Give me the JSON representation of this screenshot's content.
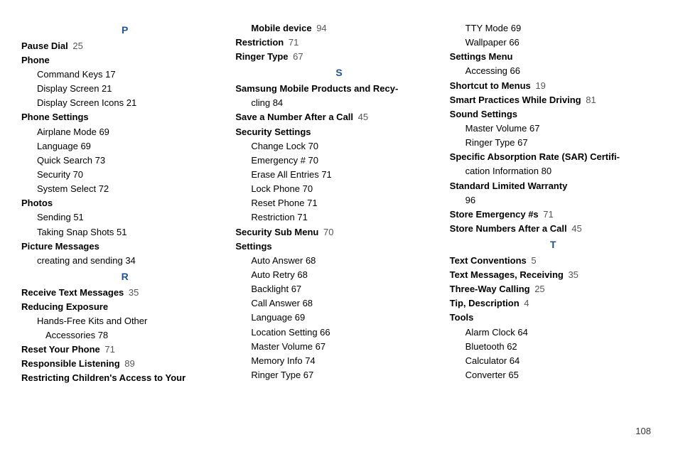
{
  "page_number": "108",
  "columns": [
    {
      "groups": [
        {
          "letter": "P",
          "entries": [
            {
              "title": "Pause Dial",
              "page": "25"
            },
            {
              "title": "Phone",
              "subs": [
                {
                  "label": "Command Keys",
                  "page": "17"
                },
                {
                  "label": "Display Screen",
                  "page": "21"
                },
                {
                  "label": "Display Screen Icons",
                  "page": "21"
                }
              ]
            },
            {
              "title": "Phone Settings",
              "subs": [
                {
                  "label": "Airplane Mode",
                  "page": "69"
                },
                {
                  "label": "Language",
                  "page": "69"
                },
                {
                  "label": "Quick Search",
                  "page": "73"
                },
                {
                  "label": "Security",
                  "page": "70"
                },
                {
                  "label": "System Select",
                  "page": "72"
                }
              ]
            },
            {
              "title": "Photos",
              "subs": [
                {
                  "label": "Sending",
                  "page": "51"
                },
                {
                  "label": "Taking Snap Shots",
                  "page": "51"
                }
              ]
            },
            {
              "title": "Picture Messages",
              "subs": [
                {
                  "label": "creating and sending",
                  "page": "34"
                }
              ]
            }
          ]
        },
        {
          "letter": "R",
          "entries": [
            {
              "title": "Receive Text Messages",
              "page": "35"
            },
            {
              "title": "Reducing Exposure",
              "subs": [
                {
                  "label": "Hands-Free Kits and Other",
                  "cont": "Accessories",
                  "page": "78"
                }
              ]
            },
            {
              "title": "Reset Your Phone",
              "page": "71"
            },
            {
              "title": "Responsible Listening",
              "page": "89"
            },
            {
              "title": "Restricting Children's Access to Your"
            }
          ]
        }
      ]
    },
    {
      "groups": [
        {
          "entries": [
            {
              "indent": true,
              "title": "Mobile device",
              "page": "94"
            },
            {
              "title": "Restriction",
              "page": "71"
            },
            {
              "title": "Ringer Type",
              "page": "67"
            }
          ]
        },
        {
          "letter": "S",
          "entries": [
            {
              "title": "Samsung Mobile Products and Recy-",
              "cont_title": "cling",
              "page": "84"
            },
            {
              "title": "Save a Number After a Call",
              "page": "45"
            },
            {
              "title": "Security Settings",
              "subs": [
                {
                  "label": "Change Lock",
                  "page": "70"
                },
                {
                  "label": "Emergency #",
                  "page": "70"
                },
                {
                  "label": "Erase All Entries",
                  "page": "71"
                },
                {
                  "label": "Lock Phone",
                  "page": "70"
                },
                {
                  "label": "Reset Phone",
                  "page": "71"
                },
                {
                  "label": "Restriction",
                  "page": "71"
                }
              ]
            },
            {
              "title": "Security Sub Menu",
              "page": "70"
            },
            {
              "title": "Settings",
              "subs": [
                {
                  "label": "Auto Answer",
                  "page": "68"
                },
                {
                  "label": "Auto Retry",
                  "page": "68"
                },
                {
                  "label": "Backlight",
                  "page": "67"
                },
                {
                  "label": "Call Answer",
                  "page": "68"
                },
                {
                  "label": "Language",
                  "page": "69"
                },
                {
                  "label": "Location Setting",
                  "page": "66"
                },
                {
                  "label": "Master Volume",
                  "page": "67"
                },
                {
                  "label": "Memory Info",
                  "page": "74"
                },
                {
                  "label": "Ringer Type",
                  "page": "67"
                }
              ]
            }
          ]
        }
      ]
    },
    {
      "groups": [
        {
          "entries": [
            {
              "pre_subs": [
                {
                  "label": "TTY Mode",
                  "page": "69"
                },
                {
                  "label": "Wallpaper",
                  "page": "66"
                }
              ]
            },
            {
              "title": "Settings Menu",
              "subs": [
                {
                  "label": "Accessing",
                  "page": "66"
                }
              ]
            },
            {
              "title": "Shortcut to Menus",
              "page": "19"
            },
            {
              "title": "Smart Practices While Driving",
              "page": "81"
            },
            {
              "title": "Sound Settings",
              "subs": [
                {
                  "label": "Master Volume",
                  "page": "67"
                },
                {
                  "label": "Ringer Type",
                  "page": "67"
                }
              ]
            },
            {
              "title": "Specific Absorption Rate (SAR) Certifi-",
              "cont_title": "cation Information",
              "page": "80"
            },
            {
              "title": "Standard Limited Warranty",
              "cont_page_only": "96"
            },
            {
              "title": "Store Emergency #s",
              "page": "71"
            },
            {
              "title": "Store Numbers After a Call",
              "page": "45"
            }
          ]
        },
        {
          "letter": "T",
          "entries": [
            {
              "title": "Text Conventions",
              "page": "5"
            },
            {
              "title": "Text Messages, Receiving",
              "page": "35"
            },
            {
              "title": "Three-Way Calling",
              "page": "25"
            },
            {
              "title": "Tip, Description",
              "page": "4"
            },
            {
              "title": "Tools",
              "subs": [
                {
                  "label": "Alarm Clock",
                  "page": "64"
                },
                {
                  "label": "Bluetooth",
                  "page": "62"
                },
                {
                  "label": "Calculator",
                  "page": "64"
                },
                {
                  "label": "Converter",
                  "page": "65"
                }
              ]
            }
          ]
        }
      ]
    }
  ]
}
